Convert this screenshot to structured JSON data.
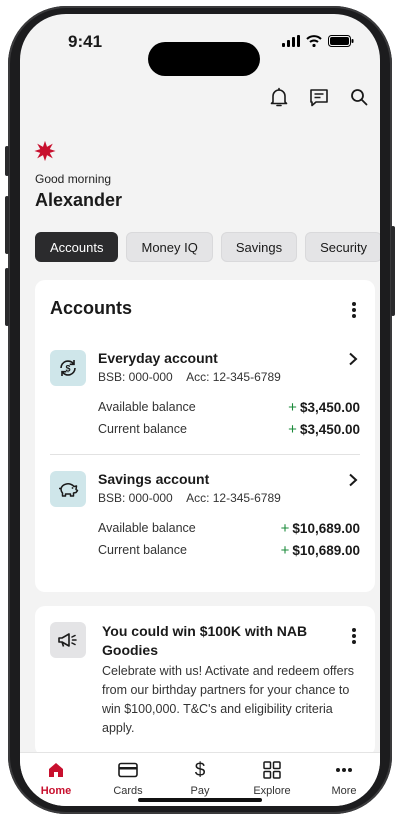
{
  "status_bar": {
    "time": "9:41"
  },
  "header": {
    "icons": [
      "bell-icon",
      "message-icon",
      "search-icon"
    ],
    "greeting": "Good morning",
    "user_name": "Alexander"
  },
  "tabs": [
    {
      "label": "Accounts",
      "active": true
    },
    {
      "label": "Money IQ",
      "active": false
    },
    {
      "label": "Savings",
      "active": false
    },
    {
      "label": "Security",
      "active": false
    }
  ],
  "accounts_card": {
    "title": "Accounts",
    "accounts": [
      {
        "name": "Everyday account",
        "bsb": "BSB: 000-000",
        "acc": "Acc: 12-345-6789",
        "icon": "refresh-arrows-icon",
        "available_label": "Available balance",
        "available_sign": "+",
        "available_amount": "$3,450.00",
        "current_label": "Current balance",
        "current_sign": "+",
        "current_amount": "$3,450.00"
      },
      {
        "name": "Savings account",
        "bsb": "BSB: 000-000",
        "acc": "Acc: 12-345-6789",
        "icon": "piggy-bank-icon",
        "available_label": "Available balance",
        "available_sign": "+",
        "available_amount": "$10,689.00",
        "current_label": "Current balance",
        "current_sign": "+",
        "current_amount": "$10,689.00"
      }
    ]
  },
  "promo": {
    "icon": "megaphone-icon",
    "title": "You could win $100K with NAB Goodies",
    "body": "Celebrate with us! Activate and redeem offers from our birthday partners for your chance to win $100,000. T&C's and eligibility criteria apply."
  },
  "bottom_nav": [
    {
      "label": "Home",
      "icon": "home-icon",
      "active": true
    },
    {
      "label": "Cards",
      "icon": "card-icon",
      "active": false
    },
    {
      "label": "Pay",
      "icon": "dollar-icon",
      "active": false
    },
    {
      "label": "Explore",
      "icon": "grid-icon",
      "active": false
    },
    {
      "label": "More",
      "icon": "more-dots-icon",
      "active": false
    }
  ],
  "colors": {
    "brand_red": "#c8102e",
    "positive_green": "#1a8a3a",
    "tab_active": "#2b2b2d",
    "icon_tile": "#cfe6ea"
  }
}
